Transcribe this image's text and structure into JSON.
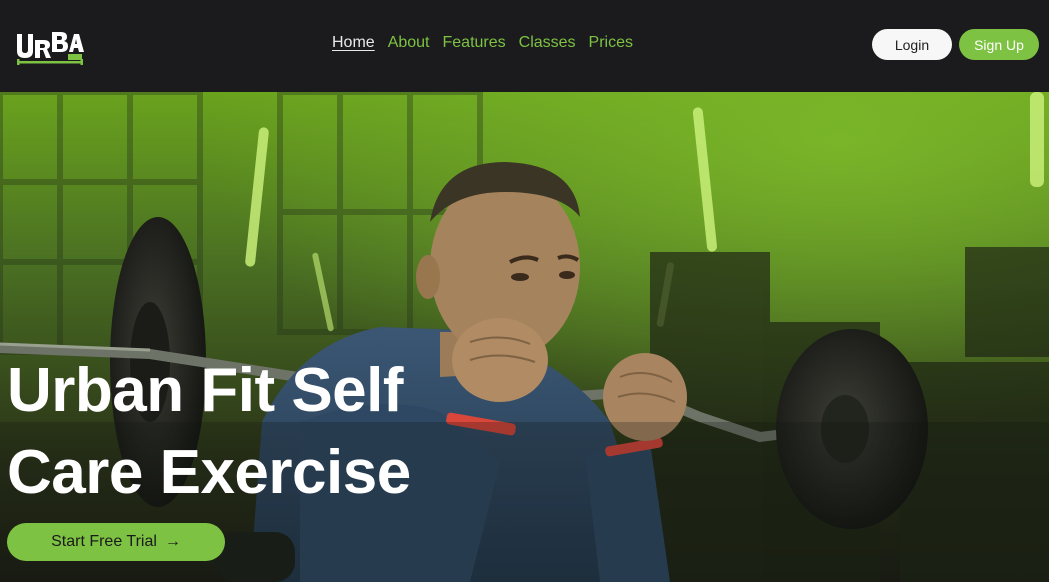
{
  "brand": {
    "logo_text": "URBAN FIT",
    "accent_color": "#7dc242",
    "header_bg": "#1b1b1d"
  },
  "nav": {
    "items": [
      {
        "label": "Home",
        "active": true
      },
      {
        "label": "About",
        "active": false
      },
      {
        "label": "Features",
        "active": false
      },
      {
        "label": "Classes",
        "active": false
      },
      {
        "label": "Prices",
        "active": false
      }
    ]
  },
  "auth": {
    "login_label": "Login",
    "signup_label": "Sign Up"
  },
  "hero": {
    "title_line1": "Urban Fit Self",
    "title_line2": "Care Exercise",
    "cta_label": "Start Free Trial",
    "cta_icon": "arrow-right-icon",
    "image_subject": "man-lifting-ez-curl-barbell"
  }
}
